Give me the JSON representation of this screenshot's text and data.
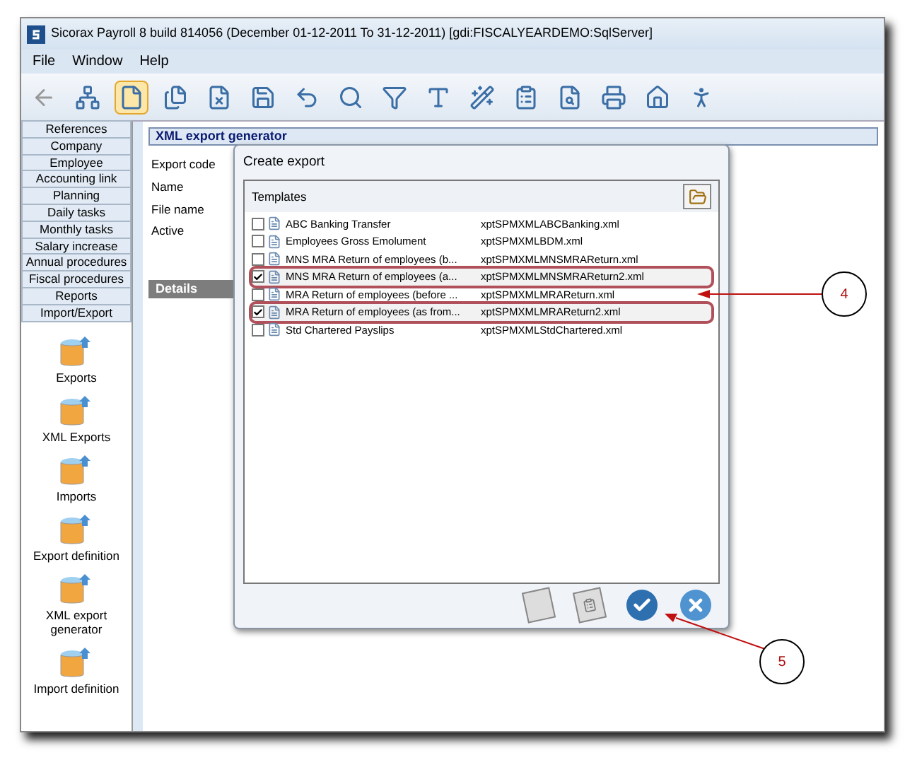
{
  "window": {
    "title": "Sicorax Payroll 8 build 814056 (December 01-12-2011 To 31-12-2011)  [gdi:FISCALYEARDEMO:SqlServer]"
  },
  "menu": [
    "File",
    "Window",
    "Help"
  ],
  "sidebar": {
    "sections": [
      "References",
      "Company",
      "Employee",
      "Accounting link",
      "Planning",
      "Daily tasks",
      "Monthly tasks",
      "Salary increase",
      "Annual procedures",
      "Fiscal procedures",
      "Reports",
      "Import/Export"
    ],
    "tools": [
      "Exports",
      "XML Exports",
      "Imports",
      "Export definition",
      "XML export generator",
      "Import definition"
    ]
  },
  "panel": {
    "title": "XML export generator",
    "fields": [
      "Export code",
      "Name",
      "File name",
      "Active"
    ],
    "details": "Details"
  },
  "dialog": {
    "title": "Create export",
    "group": "Templates",
    "templates": [
      {
        "name": "ABC Banking Transfer",
        "file": "xptSPMXMLABCBanking.xml",
        "checked": false,
        "highlighted": false
      },
      {
        "name": "Employees Gross Emolument",
        "file": "xptSPMXMLBDM.xml",
        "checked": false,
        "highlighted": false
      },
      {
        "name": "MNS MRA Return of employees (b...",
        "file": "xptSPMXMLMNSMRAReturn.xml",
        "checked": false,
        "highlighted": false
      },
      {
        "name": "MNS MRA Return of employees (a...",
        "file": "xptSPMXMLMNSMRAReturn2.xml",
        "checked": true,
        "highlighted": true
      },
      {
        "name": "MRA Return of employees (before ...",
        "file": "xptSPMXMLMRAReturn.xml",
        "checked": false,
        "highlighted": false
      },
      {
        "name": "MRA Return of employees (as from...",
        "file": "xptSPMXMLMRAReturn2.xml",
        "checked": true,
        "highlighted": true
      },
      {
        "name": "Std Chartered Payslips",
        "file": "xptSPMXMLStdChartered.xml",
        "checked": false,
        "highlighted": false
      }
    ]
  },
  "callouts": [
    {
      "label": "4"
    },
    {
      "label": "5"
    }
  ]
}
